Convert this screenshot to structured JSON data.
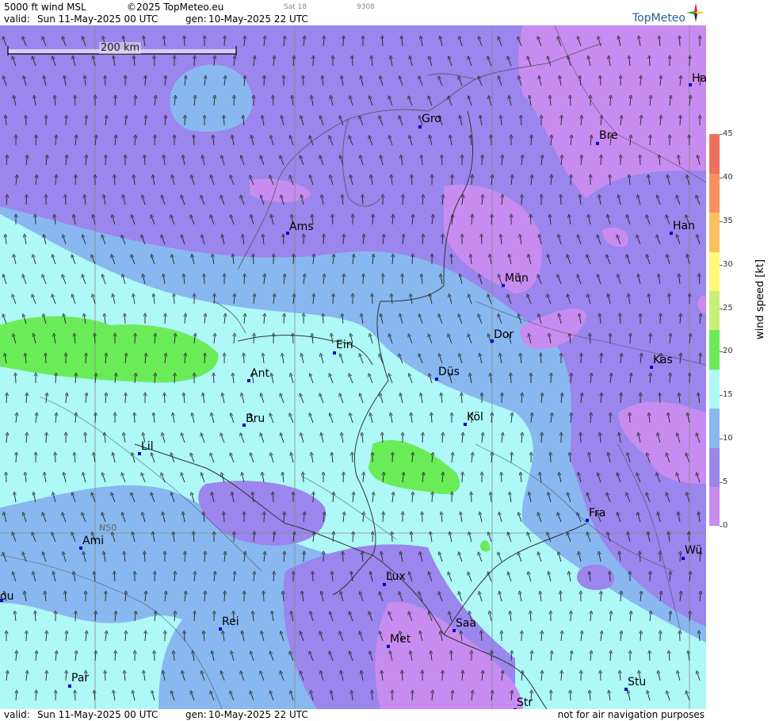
{
  "header": {
    "product": "5000 ft wind MSL",
    "copyright": "©2025 TopMeteo.eu",
    "satellite": "Sat 18",
    "code": "9308",
    "valid_label": "valid:",
    "valid_time": "Sun  11-May-2025  00 UTC",
    "gen_label": "gen:",
    "gen_time": "10-May-2025 22 UTC",
    "logo": "TopMeteo"
  },
  "map": {
    "scale_label": "200 km",
    "lat_label": "N50",
    "cities": [
      {
        "name": "Gro"
      },
      {
        "name": "Bre"
      },
      {
        "name": "Ha"
      },
      {
        "name": "Ams"
      },
      {
        "name": "Han"
      },
      {
        "name": "Mün"
      },
      {
        "name": "Dor"
      },
      {
        "name": "Ein"
      },
      {
        "name": "Kas"
      },
      {
        "name": "Düs"
      },
      {
        "name": "Ant"
      },
      {
        "name": "Köl"
      },
      {
        "name": "Bru"
      },
      {
        "name": "Lil"
      },
      {
        "name": "Fra"
      },
      {
        "name": "Ami"
      },
      {
        "name": "Wü"
      },
      {
        "name": "Lux"
      },
      {
        "name": "ou"
      },
      {
        "name": "Rei"
      },
      {
        "name": "Saa"
      },
      {
        "name": "Met"
      },
      {
        "name": "Stu"
      },
      {
        "name": "Par"
      },
      {
        "name": "Str"
      }
    ],
    "wind_direction": "arrows mostly pointing north to north-west"
  },
  "footer": {
    "valid_label": "valid:",
    "valid_time": "Sun  11-May-2025  00 UTC",
    "gen_label": "gen:",
    "gen_time": "10-May-2025 22 UTC",
    "disclaimer": "not for air navigation purposes"
  },
  "legend": {
    "title": "wind  speed  [kt]",
    "ticks": [
      "45",
      "40",
      "35",
      "30",
      "25",
      "20",
      "15",
      "10",
      "5",
      "0"
    ],
    "colors": [
      "#c88cf0",
      "#9a86ec",
      "#88b8ef",
      "#aef8f8",
      "#6aec58",
      "#c8f078",
      "#fff878",
      "#f8c060",
      "#f89060",
      "#f07060"
    ]
  },
  "colors": {
    "violet": "#c88cf0",
    "purple": "#9a86ec",
    "lightblue": "#88b8ef",
    "cyan": "#aef8f8",
    "green": "#6aec58"
  }
}
